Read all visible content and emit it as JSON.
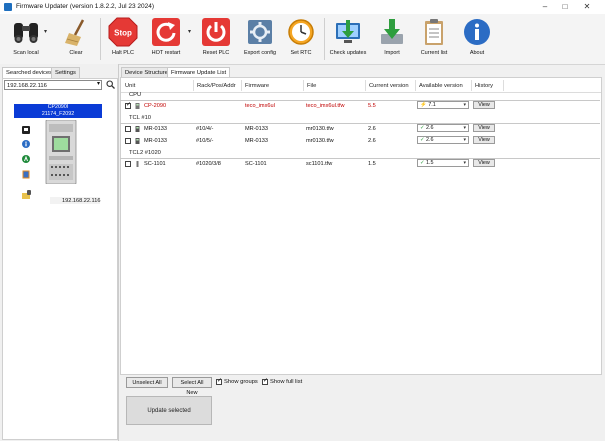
{
  "window": {
    "title": "Firmware Updater (version 1.8.2.2, Jul 23 2024)"
  },
  "toolbar": {
    "buttons": [
      {
        "label": "Scan local"
      },
      {
        "label": "Clear"
      },
      {
        "label": "Halt PLC"
      },
      {
        "label": "HOT restart"
      },
      {
        "label": "Reset PLC"
      },
      {
        "label": "Export config"
      },
      {
        "label": "Set RTC"
      },
      {
        "label": "Check updates"
      },
      {
        "label": "Import"
      },
      {
        "label": "Current list"
      },
      {
        "label": "About"
      }
    ],
    "stop_icon_text": "Stop"
  },
  "left_tabs": [
    "Searched devices",
    "Settings"
  ],
  "left_panel": {
    "ip_select_value": "192.168.22.116",
    "device_name": "CP2090I",
    "device_serial": "21174_F2092",
    "device_ip": "192.168.22.116"
  },
  "right_tabs": [
    "Device Structure",
    "Firmware Update List"
  ],
  "columns": [
    "Unit",
    "Rack/Pos/Addr",
    "Firmware",
    "File",
    "Current version",
    "Available version",
    "History"
  ],
  "groups": [
    {
      "label": "CPU",
      "rows": [
        {
          "unit": "CP-2090",
          "addr": "",
          "firmware": "teco_imx6ul",
          "file": "teco_imx6ul.tfw",
          "current": "5.5",
          "available": "7.1",
          "history": "View",
          "checked": true,
          "red": true
        }
      ]
    },
    {
      "label": "TCL #10",
      "rows": [
        {
          "unit": "MR-0133",
          "addr": "#10/4/-",
          "firmware": "MR-0133",
          "file": "mr0130.tfw",
          "current": "2.6",
          "available": "2.6",
          "history": "View",
          "checked": false,
          "red": false
        },
        {
          "unit": "MR-0133",
          "addr": "#10/5/-",
          "firmware": "MR-0133",
          "file": "mr0130.tfw",
          "current": "2.6",
          "available": "2.6",
          "history": "View",
          "checked": false,
          "red": false
        }
      ]
    },
    {
      "label": "TCL2 #1020",
      "rows": [
        {
          "unit": "SC-1101",
          "addr": "#1020/3/8",
          "firmware": "SC-1101",
          "file": "sc1101.tfw",
          "current": "1.5",
          "available": "1.5",
          "history": "View",
          "checked": false,
          "red": false
        }
      ]
    }
  ],
  "footer": {
    "unselect_all": "Unselect All",
    "select_all_new": "Select All New",
    "show_groups": "Show groups",
    "show_full_list": "Show full list",
    "show_groups_checked": true,
    "show_full_list_checked": true,
    "update_selected": "Update selected"
  },
  "colors": {
    "badge": "#0a3bd6",
    "red_text": "#c00000",
    "halt": "#e53935"
  }
}
